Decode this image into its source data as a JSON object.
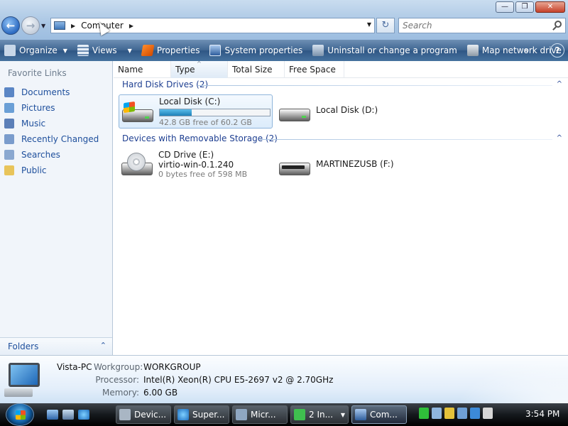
{
  "window": {
    "buttons": {
      "minimize": "—",
      "maximize": "❐",
      "close": "✕"
    }
  },
  "address_bar": {
    "path_label": "Computer",
    "refresh_symbol": "↻"
  },
  "search": {
    "placeholder": "Search"
  },
  "toolbar": {
    "items": [
      {
        "label": "Organize",
        "icon": "organize-icon",
        "has_dropdown": true
      },
      {
        "label": "Views",
        "icon": "views-icon",
        "has_dropdown": true
      },
      {
        "label": "Properties",
        "icon": "properties-icon"
      },
      {
        "label": "System properties",
        "icon": "system-properties-icon"
      },
      {
        "label": "Uninstall or change a program",
        "icon": "uninstall-icon"
      },
      {
        "label": "Map network drive",
        "icon": "map-network-drive-icon"
      }
    ],
    "more": "»",
    "help": "?"
  },
  "navigation_pane": {
    "title": "Favorite Links",
    "links": [
      {
        "label": "Documents",
        "icon": "documents-icon",
        "color": "#5a86c5"
      },
      {
        "label": "Pictures",
        "icon": "pictures-icon",
        "color": "#6a9fd6"
      },
      {
        "label": "Music",
        "icon": "music-icon",
        "color": "#5b7fb8"
      },
      {
        "label": "Recently Changed",
        "icon": "recently-changed-icon",
        "color": "#7a9ccc"
      },
      {
        "label": "Searches",
        "icon": "searches-icon",
        "color": "#8aa8d0"
      },
      {
        "label": "Public",
        "icon": "public-folder-icon",
        "color": "#e8c45a"
      }
    ],
    "folders_label": "Folders"
  },
  "columns": [
    "Name",
    "Type",
    "Total Size",
    "Free Space"
  ],
  "groups": {
    "hard_disks": {
      "title": "Hard Disk Drives (2)",
      "drives": [
        {
          "name": "Local Disk (C:)",
          "free_text": "42.8 GB free of 60.2 GB",
          "used_fraction": 0.289,
          "selected": true
        },
        {
          "name": "Local Disk (D:)"
        }
      ]
    },
    "removable": {
      "title": "Devices with Removable Storage (2)",
      "drives": [
        {
          "name": "CD Drive (E:)",
          "label": "virtio-win-0.1.240",
          "free_text": "0 bytes free of 598 MB"
        },
        {
          "name": "MARTINEZUSB (F:)"
        }
      ]
    }
  },
  "details": {
    "computer_name": "Vista-PC",
    "rows": [
      {
        "label": "Workgroup:",
        "value": "WORKGROUP"
      },
      {
        "label": "Processor:",
        "value": "Intel(R) Xeon(R) CPU E5-2697 v2 @ 2.70GHz"
      },
      {
        "label": "Memory:",
        "value": "6.00 GB"
      }
    ]
  },
  "taskbar": {
    "tasks": [
      {
        "label": "Devic...",
        "icon": "device-manager-icon"
      },
      {
        "label": "Super...",
        "icon": "internet-explorer-icon"
      },
      {
        "label": "Micr...",
        "icon": "microsoft-app-icon"
      },
      {
        "label": "2 In...",
        "icon": "installer-icon"
      },
      {
        "label": "Com...",
        "icon": "computer-icon",
        "active": true
      }
    ],
    "clock": "3:54 PM"
  },
  "colors": {
    "toolbar": "#3e6591",
    "link": "#1e4f9c",
    "group_title": "#1e3f91",
    "disk_fill": "#1c80b8"
  }
}
